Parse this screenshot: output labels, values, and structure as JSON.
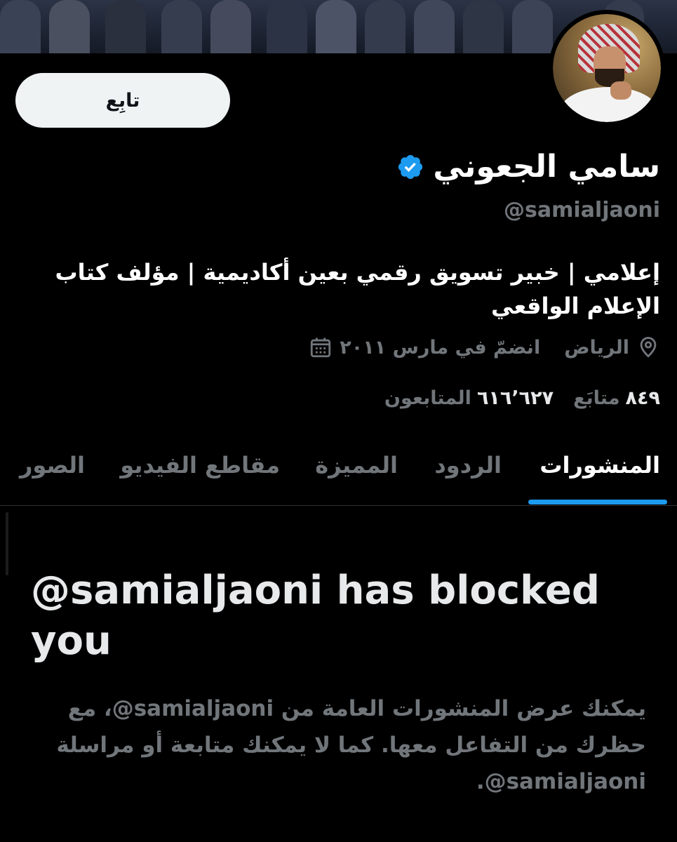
{
  "profile": {
    "display_name": "سامي الجعوني",
    "handle": "@samialjaoni",
    "bio": "إعلامي | خبير تسويق رقمي بعين أكاديمية | مؤلف كتاب الإعلام الواقعي",
    "location": "الرياض",
    "joined": "انضمّ في مارس ٢٠١١",
    "following_count": "٨٤٩",
    "following_label": "متابَع",
    "followers_count": "٦١٦٬٦٢٧",
    "followers_label": "المتابعون"
  },
  "actions": {
    "follow_label": "تابِع"
  },
  "tabs": [
    {
      "label": "المنشورات",
      "active": true
    },
    {
      "label": "الردود",
      "active": false
    },
    {
      "label": "المميزة",
      "active": false
    },
    {
      "label": "مقاطع الفيديو",
      "active": false
    },
    {
      "label": "الصور",
      "active": false
    }
  ],
  "blocked": {
    "title": "@samialjaoni has blocked you",
    "description": "يمكنك عرض المنشورات العامة من samialjaoni@، مع حظرك من التفاعل معها. كما لا يمكنك متابعة أو مراسلة samialjaoni@."
  },
  "colors": {
    "accent": "#1d9bf0",
    "background": "#000000",
    "text_secondary": "#71767b"
  },
  "icons": {
    "verified": "verified-badge-icon",
    "location": "location-pin-icon",
    "calendar": "calendar-icon"
  }
}
